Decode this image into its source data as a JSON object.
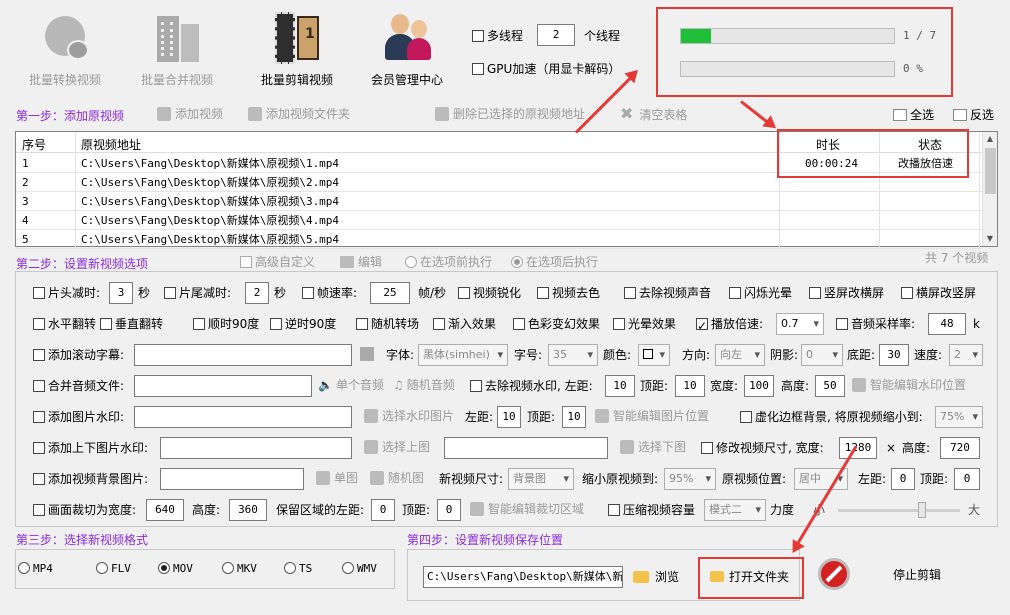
{
  "toolbar": {
    "batch_convert": "批量转换视频",
    "batch_merge": "批量合并视频",
    "batch_edit": "批量剪辑视频",
    "member_center": "会员管理中心"
  },
  "thread": {
    "multi_label": "多线程",
    "count": "2",
    "unit": "个线程",
    "gpu_label": "GPU加速（用显卡解码）"
  },
  "progress": {
    "overall_text": "1 / 7",
    "overall_fraction": 0.14,
    "current_text": "0 %",
    "current_fraction": 0
  },
  "step1": {
    "title": "第一步：添加原视频",
    "add_video": "添加视频",
    "add_folder": "添加视频文件夹",
    "delete_selected": "删除已选择的原视频地址",
    "clear_table": "清空表格",
    "select_all": "全选",
    "invert": "反选"
  },
  "table": {
    "headers": {
      "num": "序号",
      "path": "原视频地址",
      "duration": "时长",
      "status": "状态"
    },
    "rows": [
      {
        "num": "1",
        "path": "C:\\Users\\Fang\\Desktop\\新媒体\\原视频\\1.mp4",
        "duration": "00:00:24",
        "status": "改播放倍速"
      },
      {
        "num": "2",
        "path": "C:\\Users\\Fang\\Desktop\\新媒体\\原视频\\2.mp4",
        "duration": "",
        "status": ""
      },
      {
        "num": "3",
        "path": "C:\\Users\\Fang\\Desktop\\新媒体\\原视频\\3.mp4",
        "duration": "",
        "status": ""
      },
      {
        "num": "4",
        "path": "C:\\Users\\Fang\\Desktop\\新媒体\\原视频\\4.mp4",
        "duration": "",
        "status": ""
      },
      {
        "num": "5",
        "path": "C:\\Users\\Fang\\Desktop\\新媒体\\原视频\\5.mp4",
        "duration": "",
        "status": ""
      }
    ]
  },
  "step2": {
    "title": "第二步：设置新视频选项",
    "advanced": "高级自定义",
    "edit": "编辑",
    "before": "在选项前执行",
    "after": "在选项后执行",
    "total": "共 7 个视频"
  },
  "opt": {
    "head_cut": "片头减时:",
    "head_val": "3",
    "sec1": "秒",
    "tail_cut": "片尾减时:",
    "tail_val": "2",
    "sec2": "秒",
    "fps": "帧速率:",
    "fps_val": "25",
    "fps_unit": "帧/秒",
    "sharpen": "视频锐化",
    "decolor": "视频去色",
    "remove_audio": "去除视频声音",
    "flash": "闪烁光晕",
    "v2h": "竖屏改横屏",
    "h2v": "横屏改竖屏",
    "hflip": "水平翻转",
    "vflip": "垂直翻转",
    "cw90": "顺时90度",
    "ccw90": "逆时90度",
    "random_trans": "随机转场",
    "fade_in": "渐入效果",
    "color_shift": "色彩变幻效果",
    "glow": "光晕效果",
    "speed": "播放倍速:",
    "speed_val": "0.7",
    "sample_rate": "音频采样率:",
    "sample_val": "48",
    "sample_unit": "k",
    "scroll_sub": "添加滚动字幕:",
    "font": "字体:",
    "font_val": "黑体(simhei)",
    "size": "字号:",
    "size_val": "35",
    "color": "颜色:",
    "direction": "方向:",
    "direction_val": "向左",
    "shadow": "阴影:",
    "shadow_val": "0",
    "bottom": "底距:",
    "bottom_val": "30",
    "spd": "速度:",
    "spd_val": "2",
    "merge_audio": "合并音频文件:",
    "single_audio": "单个音频",
    "random_audio": "随机音频",
    "remove_wm": "去除视频水印, 左距:",
    "wm_left": "10",
    "top1": "顶距:",
    "wm_top": "10",
    "width1": "宽度:",
    "wm_w": "100",
    "height1": "高度:",
    "wm_h": "50",
    "smart_wm": "智能编辑水印位置",
    "img_wm": "添加图片水印:",
    "choose_wm": "选择水印图片",
    "left2": "左距:",
    "img_left": "10",
    "top2": "顶距:",
    "img_top": "10",
    "smart_img": "智能编辑图片位置",
    "blur_bg": "虚化边框背景, 将原视频缩小到:",
    "blur_val": "75%",
    "tb_img": "添加上下图片水印:",
    "choose_top": "选择上图",
    "choose_bottom": "选择下图",
    "resize": "修改视频尺寸, 宽度:",
    "resize_w": "1280",
    "times": "×",
    "height3": "高度:",
    "resize_h": "720",
    "bg_img": "添加视频背景图片:",
    "single_img": "单图",
    "random_img": "随机图",
    "new_size": "新视频尺寸:",
    "new_size_val": "背景图",
    "shrink": "缩小原视频到:",
    "shrink_val": "95%",
    "pos": "原视频位置:",
    "pos_val": "居中",
    "left4": "左距:",
    "pos_left": "0",
    "top4": "顶距:",
    "pos_top": "0",
    "crop": "画面裁切为宽度:",
    "crop_w": "640",
    "height5": "高度:",
    "crop_h": "360",
    "keep_left": "保留区域的左距:",
    "crop_left": "0",
    "top5": "顶距:",
    "crop_top": "0",
    "smart_crop": "智能编辑裁切区域",
    "compress": "压缩视频容量",
    "mode": "模式二",
    "strength": "力度",
    "small": "小",
    "large": "大"
  },
  "step3": {
    "title": "第三步：选择新视频格式",
    "formats": [
      "MP4",
      "FLV",
      "MOV",
      "MKV",
      "TS",
      "WMV"
    ],
    "selected": "MOV"
  },
  "step4": {
    "title": "第四步：设置新视频保存位置",
    "path": "C:\\Users\\Fang\\Desktop\\新媒体\\新建",
    "browse": "浏览",
    "open_folder": "打开文件夹",
    "stop": "停止剪辑"
  },
  "colors": {
    "accent": "#8a2be2",
    "highlight": "#e53935",
    "progress": "#1fbf3a"
  }
}
